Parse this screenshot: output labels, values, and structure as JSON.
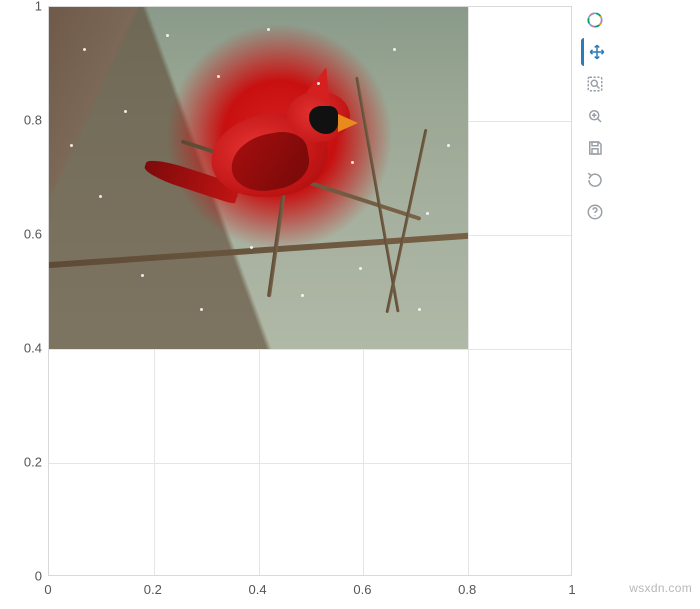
{
  "chart_data": {
    "type": "image-plot",
    "title": "",
    "xlabel": "",
    "ylabel": "",
    "xlim": [
      0,
      1
    ],
    "ylim": [
      0,
      1
    ],
    "x_ticks": [
      0,
      0.2,
      0.4,
      0.6,
      0.8,
      1
    ],
    "y_ticks": [
      0,
      0.2,
      0.4,
      0.6,
      0.8,
      1
    ],
    "grid": true,
    "image_glyph": {
      "description": "Photograph of a red northern cardinal bird perched on bare branches during snowfall",
      "extent": {
        "x0": 0.0,
        "y0": 0.4,
        "x1": 0.8,
        "y1": 1.0
      }
    }
  },
  "axes": {
    "x_tick_labels": [
      "0",
      "0.2",
      "0.4",
      "0.6",
      "0.8",
      "1"
    ],
    "y_tick_labels": [
      "0",
      "0.2",
      "0.4",
      "0.6",
      "0.8",
      "1"
    ]
  },
  "toolbar": {
    "logo_name": "bokeh-logo",
    "tools": [
      {
        "id": "pan",
        "name": "pan-icon",
        "title": "Pan",
        "active": true
      },
      {
        "id": "box-zoom",
        "name": "box-zoom-icon",
        "title": "Box Zoom",
        "active": false
      },
      {
        "id": "wheel-zoom",
        "name": "wheel-zoom-icon",
        "title": "Wheel Zoom",
        "active": false
      },
      {
        "id": "save",
        "name": "save-icon",
        "title": "Save",
        "active": false
      },
      {
        "id": "reset",
        "name": "reset-icon",
        "title": "Reset",
        "active": false
      },
      {
        "id": "help",
        "name": "help-icon",
        "title": "Help",
        "active": false
      }
    ]
  },
  "watermark": "wsxdn.com"
}
